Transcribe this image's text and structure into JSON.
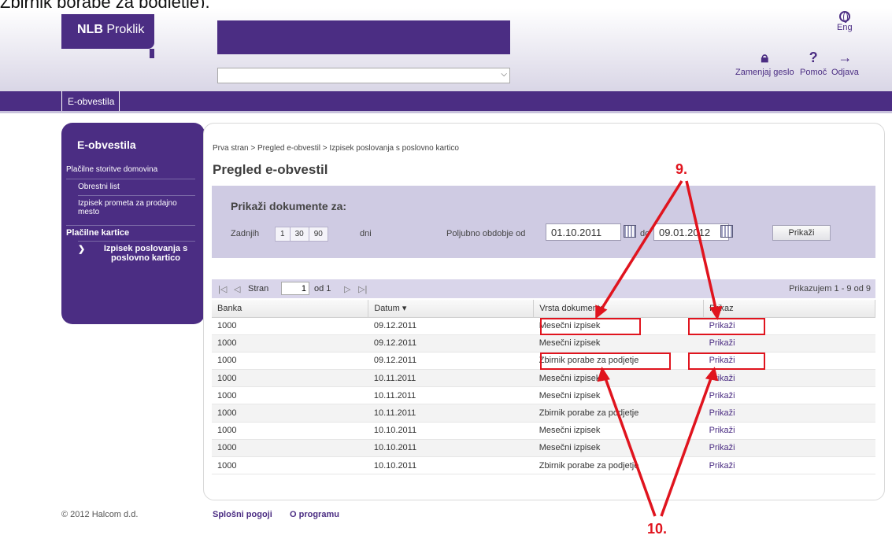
{
  "caption": "Zbirnik porabe za podjetje).",
  "header": {
    "logo_bold": "NLB",
    "logo_rest": "Proklik",
    "lang_label": "Eng",
    "change_password": "Zamenjaj geslo",
    "help": "Pomoč",
    "logout": "Odjava"
  },
  "nav": {
    "tab": "E-obvestila"
  },
  "sidebar": {
    "title": "E-obvestila",
    "items": [
      "Plačilne storitve domovina",
      "Obrestni list",
      "Izpisek prometa za prodajno mesto",
      "Plačilne kartice",
      "Izpisek poslovanja s poslovno kartico"
    ]
  },
  "breadcrumb": "Prva stran > Pregled e-obvestil > Izpisek poslovanja s poslovno kartico",
  "page_title": "Pregled e-obvestil",
  "filter": {
    "heading": "Prikaži dokumente za:",
    "last_label": "Zadnjih",
    "periods": [
      "1",
      "30",
      "90"
    ],
    "days_label": "dni",
    "custom_label": "Poljubno obdobje od",
    "date_from": "01.10.2011",
    "to_label": "do",
    "date_to": "09.01.2012",
    "show_button": "Prikaži"
  },
  "pager": {
    "page_label": "Stran",
    "page_value": "1",
    "of_label": "od 1",
    "summary": "Prikazujem 1 - 9 od 9"
  },
  "table": {
    "headers": [
      "Banka",
      "Datum ▾",
      "Vrsta dokumenta",
      "Prikaz"
    ],
    "rows": [
      [
        "1000",
        "09.12.2011",
        "Mesečni izpisek",
        "Prikaži"
      ],
      [
        "1000",
        "09.12.2011",
        "Mesečni izpisek",
        "Prikaži"
      ],
      [
        "1000",
        "09.12.2011",
        "Zbirnik porabe za podjetje",
        "Prikaži"
      ],
      [
        "1000",
        "10.11.2011",
        "Mesečni izpisek",
        "Prikaži"
      ],
      [
        "1000",
        "10.11.2011",
        "Mesečni izpisek",
        "Prikaži"
      ],
      [
        "1000",
        "10.11.2011",
        "Zbirnik porabe za podjetje",
        "Prikaži"
      ],
      [
        "1000",
        "10.10.2011",
        "Mesečni izpisek",
        "Prikaži"
      ],
      [
        "1000",
        "10.10.2011",
        "Mesečni izpisek",
        "Prikaži"
      ],
      [
        "1000",
        "10.10.2011",
        "Zbirnik porabe za podjetje",
        "Prikaži"
      ]
    ]
  },
  "annotations": {
    "label_9": "9.",
    "label_10": "10."
  },
  "footer": {
    "copyright": "© 2012 Halcom d.d.",
    "terms": "Splošni pogoji",
    "about": "O programu"
  },
  "colors": {
    "brand": "#4b2d83",
    "annotation": "#e0141e"
  },
  "icons": [
    "globe-icon",
    "lock-icon",
    "help-icon",
    "logout-icon",
    "calendar-icon",
    "chevron-right-icon"
  ]
}
